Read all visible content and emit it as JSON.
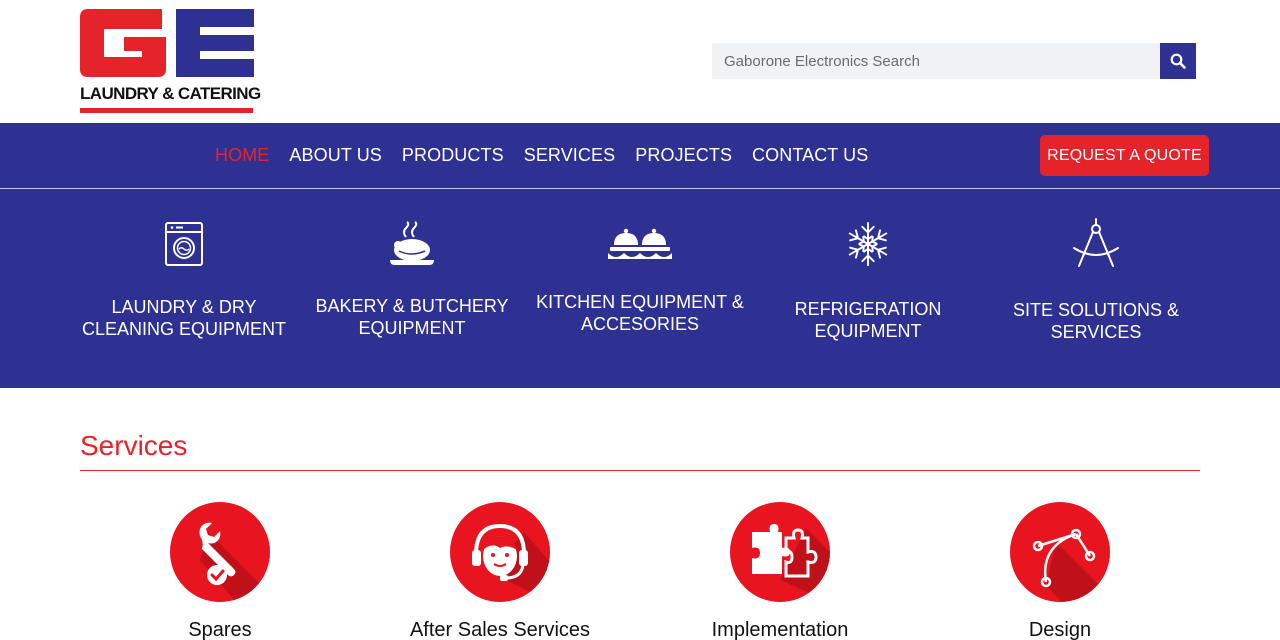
{
  "header": {
    "logo_initials": "GE",
    "logo_text": "LAUNDRY & CATERING",
    "search": {
      "placeholder": "Gaborone Electronics Search",
      "button_icon": "search-icon"
    }
  },
  "nav": {
    "links": [
      {
        "label": "HOME",
        "active": true
      },
      {
        "label": "ABOUT US"
      },
      {
        "label": "PRODUCTS"
      },
      {
        "label": "SERVICES"
      },
      {
        "label": "PROJECTS"
      },
      {
        "label": "CONTACT US"
      }
    ],
    "quote_button": "REQUEST A QUOTE"
  },
  "categories": [
    {
      "line1": "LAUNDRY & DRY",
      "line2": "CLEANING EQUIPMENT",
      "icon": "washing-machine-icon"
    },
    {
      "line1": "BAKERY & BUTCHERY",
      "line2": "EQUIPMENT",
      "icon": "roast-dish-icon"
    },
    {
      "line1": "KITCHEN EQUIPMENT &",
      "line2": "ACCESORIES",
      "icon": "cloche-icon"
    },
    {
      "line1": "REFRIGERATION",
      "line2": "EQUIPMENT",
      "icon": "snowflake-icon"
    },
    {
      "line1": "SITE SOLUTIONS &",
      "line2": "SERVICES",
      "icon": "compass-icon"
    }
  ],
  "services": {
    "title": "Services",
    "items": [
      {
        "label": "Spares",
        "icon": "wrench-icon"
      },
      {
        "label": "After Sales Services",
        "icon": "headset-support-icon"
      },
      {
        "label": "Implementation",
        "icon": "puzzle-icon"
      },
      {
        "label": "Design",
        "icon": "bezier-curve-icon"
      }
    ]
  },
  "colors": {
    "brand_blue": "#2e3192",
    "brand_red": "#e5232b",
    "circle_red": "#e8141f",
    "search_bg": "#f1f2f4"
  }
}
